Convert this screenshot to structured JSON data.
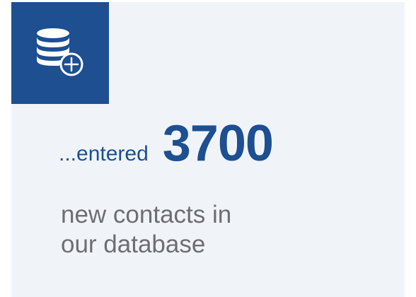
{
  "icon": {
    "name": "database-add-icon"
  },
  "stat": {
    "prefix": "...entered",
    "number": "3700",
    "line1": "new contacts in",
    "line2": "our database"
  },
  "colors": {
    "brand_blue": "#1d4f91",
    "card_background": "#f0f4f9",
    "muted_text": "#6d6e71"
  }
}
